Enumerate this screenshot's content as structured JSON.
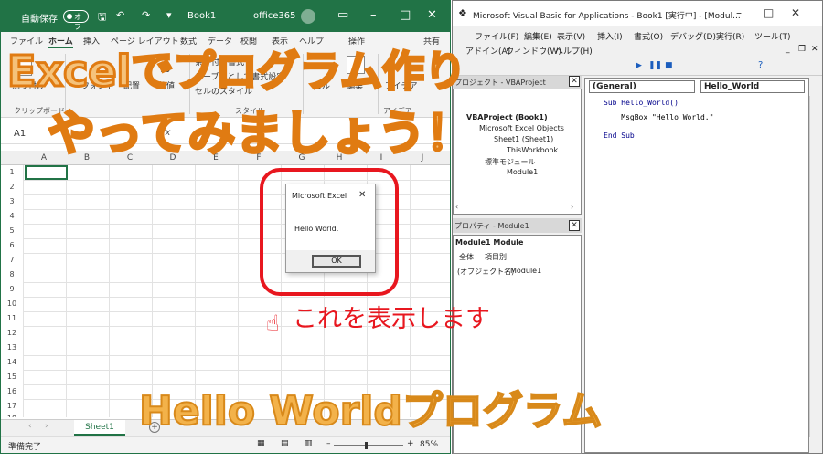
{
  "excel": {
    "autosave_label": "自動保存",
    "autosave_state": "オフ",
    "book_name": "Book1",
    "account": "office365",
    "tabs": [
      "ファイル",
      "ホーム",
      "挿入",
      "ページ レイアウト",
      "数式",
      "データ",
      "校閲",
      "表示",
      "ヘルプ",
      "操作",
      "共有"
    ],
    "ribbon": {
      "paste": "貼り付け",
      "font": "フォント",
      "align": "配置",
      "number": "数値",
      "cond_format": "条件付き書式",
      "table_format": "テーブルとして書式設定",
      "cell_style": "セルのスタイル",
      "cells": "セル",
      "edit": "編集",
      "idea": "アイデア",
      "clipboard": "クリップボード",
      "style": "スタイル",
      "idea_group": "アイデア"
    },
    "name_box": "A1",
    "fx": "fx",
    "columns": [
      "A",
      "B",
      "C",
      "D",
      "E",
      "F",
      "G",
      "H",
      "I",
      "J"
    ],
    "rows": [
      "1",
      "2",
      "3",
      "4",
      "5",
      "6",
      "7",
      "8",
      "9",
      "10",
      "11",
      "12",
      "13",
      "14",
      "15",
      "16",
      "17",
      "18"
    ],
    "sheet_tab": "Sheet1",
    "status": "準備完了",
    "zoom": "85%"
  },
  "dialog": {
    "title": "Microsoft Excel",
    "close": "✕",
    "message": "Hello World.",
    "ok": "OK"
  },
  "callout": {
    "pointer": "☝",
    "text": "これを表示します"
  },
  "vba": {
    "title": "Microsoft Visual Basic for Applications - Book1 [実行中] - [Modul...",
    "menu": [
      "ファイル(F)",
      "編集(E)",
      "表示(V)",
      "挿入(I)",
      "書式(O)",
      "デバッグ(D)",
      "実行(R)",
      "ツール(T)",
      "アドイン(A)",
      "ウィンドウ(W)",
      "ヘルプ(H)"
    ],
    "project_title": "プロジェクト - VBAProject",
    "tree": [
      "VBAProject (Book1)",
      "Microsoft Excel Objects",
      "Sheet1 (Sheet1)",
      "ThisWorkbook",
      "標準モジュール",
      "Module1"
    ],
    "props_title": "プロパティ - Module1",
    "props_combo": "Module1 Module",
    "props_tabs": [
      "全体",
      "項目別"
    ],
    "props_row": [
      "(オブジェクト名)",
      "Module1"
    ],
    "combo_general": "(General)",
    "combo_proc": "Hello_World",
    "code": [
      "Sub Hello_World()",
      "    MsgBox \"Hello World.\"",
      "End Sub"
    ]
  },
  "overlay": {
    "line1": "Excelでプログラム作り",
    "line2": "やってみましょう！",
    "line3": "Hello Worldプログラム"
  },
  "colors": {
    "excel_green": "#217346",
    "accent_red": "#e8171f",
    "overlay_orange": "#f5c27a"
  }
}
